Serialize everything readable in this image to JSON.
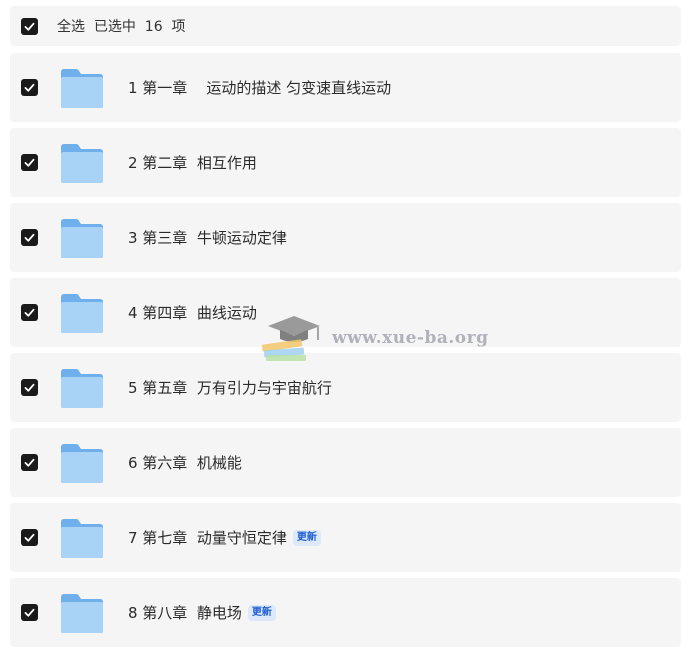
{
  "header": {
    "select_all_label": "全选  已选中  16  项",
    "checked": true
  },
  "items": [
    {
      "title": "1 第一章    运动的描述 匀变速直线运动",
      "checked": true,
      "badge": ""
    },
    {
      "title": "2 第二章  相互作用",
      "checked": true,
      "badge": ""
    },
    {
      "title": "3 第三章  牛顿运动定律",
      "checked": true,
      "badge": ""
    },
    {
      "title": "4 第四章  曲线运动",
      "checked": true,
      "badge": ""
    },
    {
      "title": "5 第五章  万有引力与宇宙航行",
      "checked": true,
      "badge": ""
    },
    {
      "title": "6 第六章  机械能",
      "checked": true,
      "badge": ""
    },
    {
      "title": "7 第七章  动量守恒定律",
      "checked": true,
      "badge": "更新"
    },
    {
      "title": "8 第八章  静电场",
      "checked": true,
      "badge": "更新"
    }
  ],
  "watermark": {
    "text": "www.xue-ba.org"
  },
  "colors": {
    "row_bg": "#f5f5f5",
    "checkbox": "#1a1a1a",
    "folder": "#9cc9f3",
    "badge_text": "#1f5fd1",
    "badge_bg": "#dde8fb"
  },
  "icons": {
    "checkbox": "checkbox-checked-icon",
    "folder": "folder-icon",
    "watermark": "graduation-cap-books-icon"
  }
}
